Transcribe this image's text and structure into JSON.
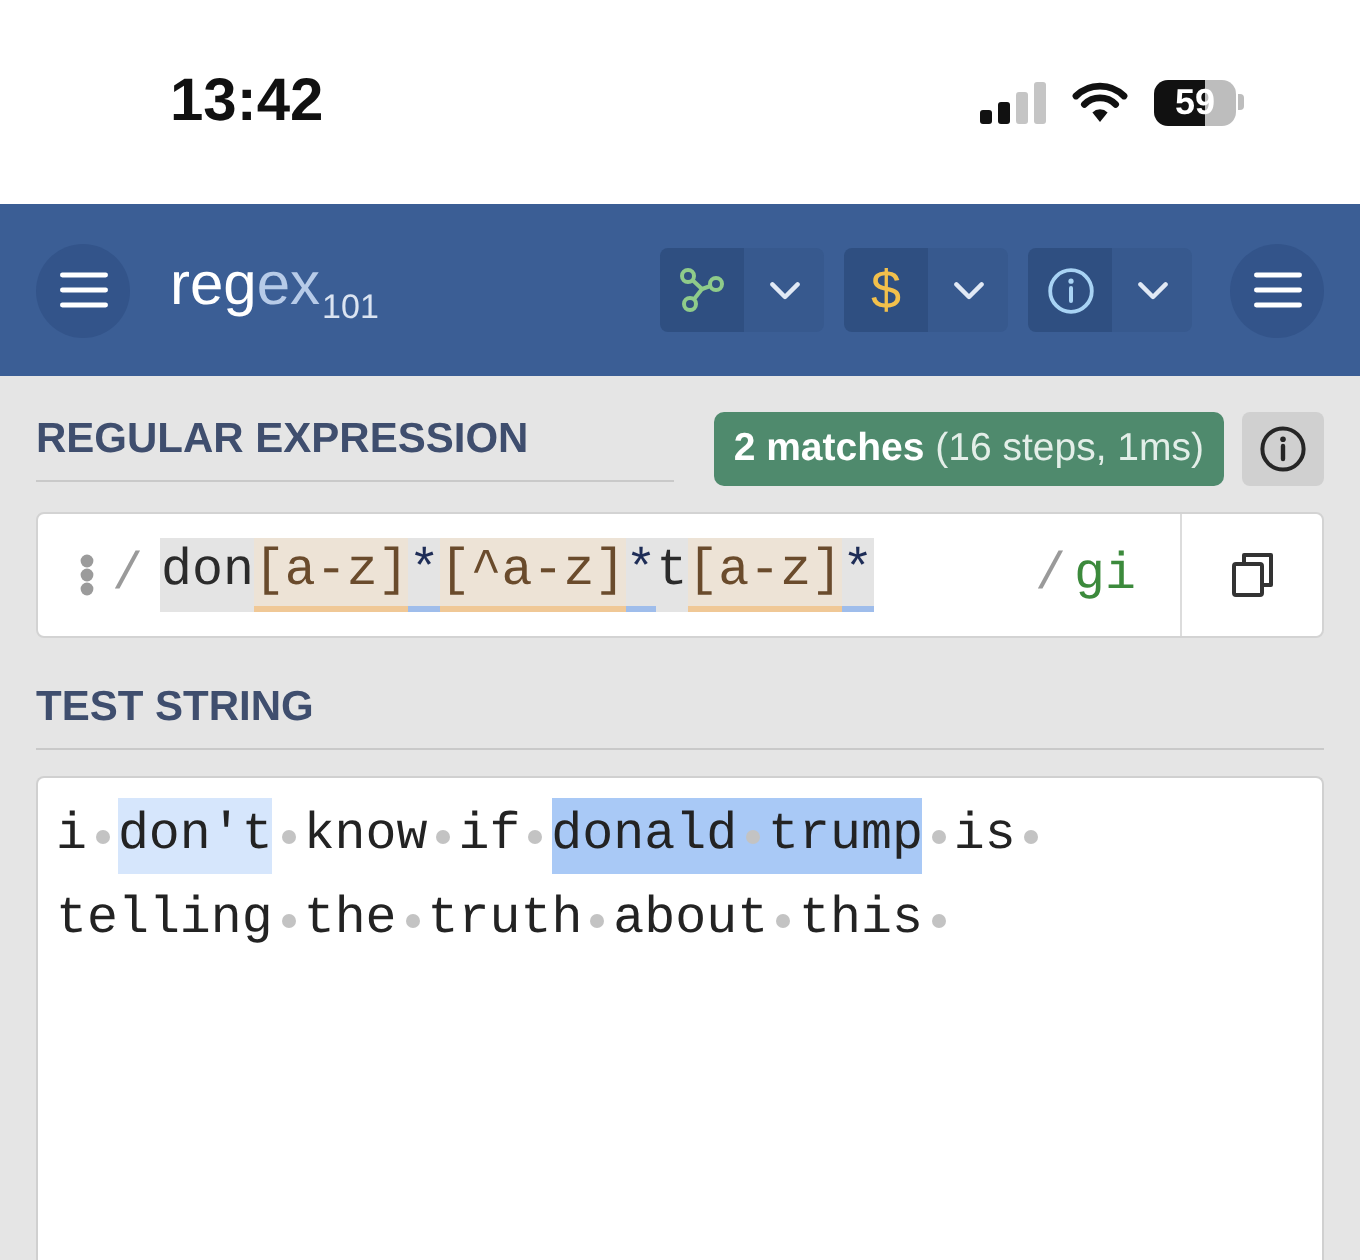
{
  "status_bar": {
    "time": "13:42",
    "battery": "59"
  },
  "header": {
    "logo": [
      {
        "text": "reg",
        "kind": "base"
      },
      {
        "text": "ex",
        "kind": "accent"
      },
      {
        "text": "101",
        "kind": "subscript"
      }
    ],
    "tools": [
      {
        "kind": "graph"
      },
      {
        "kind": "glyph",
        "glyph": "$"
      },
      {
        "kind": "info"
      }
    ]
  },
  "regex_section": {
    "label": "REGULAR EXPRESSION",
    "match_summary": "**2 matches** (16 steps, 1ms)",
    "open_delimiter": "/",
    "tokens": [
      {
        "text": "don",
        "kind": "literal"
      },
      {
        "text": "[a-z]",
        "kind": "class"
      },
      {
        "text": "*",
        "kind": "quantifier"
      },
      {
        "text": "[^a-z]",
        "kind": "class"
      },
      {
        "text": "*",
        "kind": "quantifier"
      },
      {
        "text": "t",
        "kind": "literal"
      },
      {
        "text": "[a-z]",
        "kind": "class"
      },
      {
        "text": "*",
        "kind": "quantifier"
      }
    ],
    "close_delimiter": "/",
    "flags": "gi"
  },
  "test_section": {
    "label": "TEST STRING",
    "lines": [
      [
        {
          "text": "i",
          "match": false
        },
        {
          "text": "don't",
          "match": true,
          "color": "#d6e6fc"
        },
        {
          "text": "know",
          "match": false
        },
        {
          "text": "if",
          "match": false
        },
        {
          "text": "donald trump",
          "match": true,
          "color": "#a9c9f6"
        },
        {
          "text": "is",
          "match": false
        }
      ],
      [
        {
          "text": "telling",
          "match": false
        },
        {
          "text": "the",
          "match": false
        },
        {
          "text": "truth",
          "match": false
        },
        {
          "text": "about",
          "match": false
        },
        {
          "text": "this",
          "match": false
        }
      ]
    ]
  }
}
